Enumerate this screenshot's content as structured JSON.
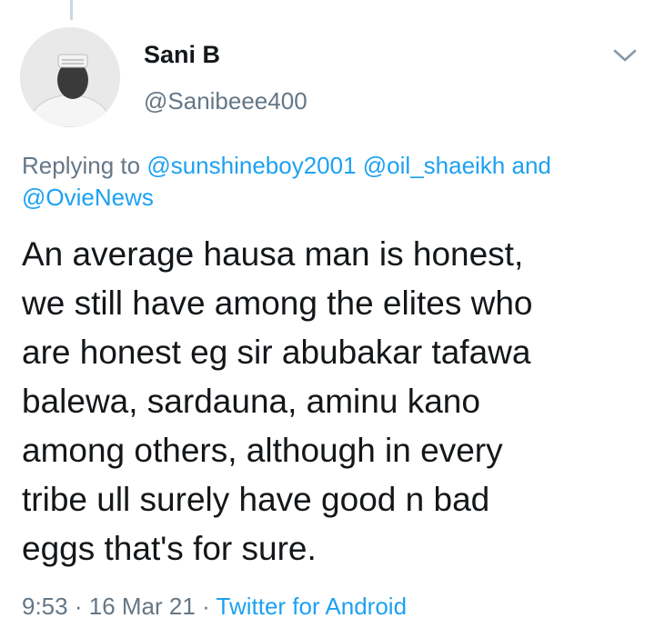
{
  "tweet": {
    "author": {
      "name": "Sani B",
      "handle": "@Sanibeee400"
    },
    "reply": {
      "prefix": "Replying to",
      "mention1": "@sunshineboy2001",
      "mention2": "@oil_shaeikh",
      "conjunction": "and",
      "mention3": "@OvieNews"
    },
    "lines": [
      "An average hausa man is honest,",
      "we still have among the elites who",
      "are honest eg sir abubakar tafawa",
      "balewa, sardauna, aminu kano",
      "among others, although in every",
      "tribe ull surely have good n bad",
      "eggs that's for sure."
    ],
    "time": "9:53",
    "separator": "·",
    "date": "16 Mar 21",
    "source": "Twitter for Android"
  },
  "colors": {
    "primary_text": "#14171a",
    "secondary_text": "#657786",
    "link": "#1da1f2",
    "thread_line": "#ccd6dd"
  },
  "icons": {
    "menu": "chevron-down-icon"
  }
}
